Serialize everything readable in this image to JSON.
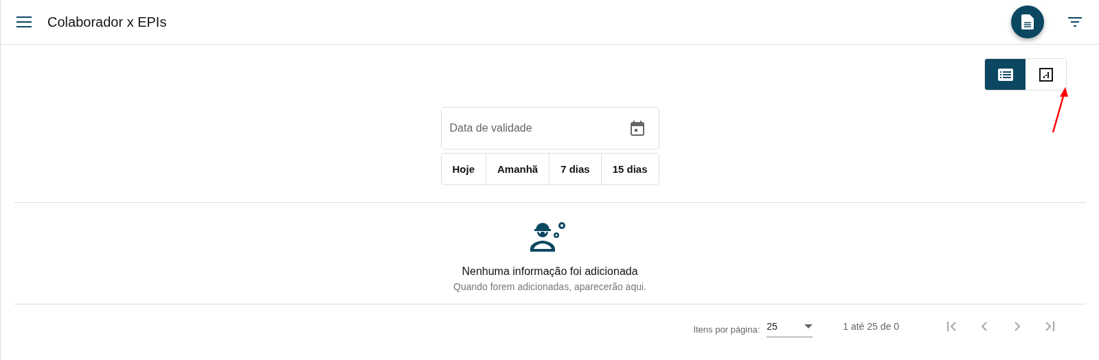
{
  "header": {
    "title": "Colaborador x EPIs"
  },
  "view_toggle": [
    {
      "kind": "list",
      "selected": true
    },
    {
      "kind": "chart",
      "selected": false
    }
  ],
  "date_field": {
    "placeholder": "Data de validade"
  },
  "quick_filters": [
    {
      "label": "Hoje",
      "selected": false
    },
    {
      "label": "Amanhã",
      "selected": false
    },
    {
      "label": "7 dias",
      "selected": false
    },
    {
      "label": "15 dias",
      "selected": false
    }
  ],
  "empty_state": {
    "title": "Nenhuma informação foi adicionada",
    "subtitle": "Quando forem adicionadas, aparecerão aqui."
  },
  "paginator": {
    "page_size_label": "Itens por página:",
    "page_size": "25",
    "range": "1 até 25 de 0",
    "nav": [
      {
        "kind": "first",
        "disabled": true
      },
      {
        "kind": "prev",
        "disabled": true
      },
      {
        "kind": "next",
        "disabled": true
      },
      {
        "kind": "last",
        "disabled": true
      }
    ]
  }
}
